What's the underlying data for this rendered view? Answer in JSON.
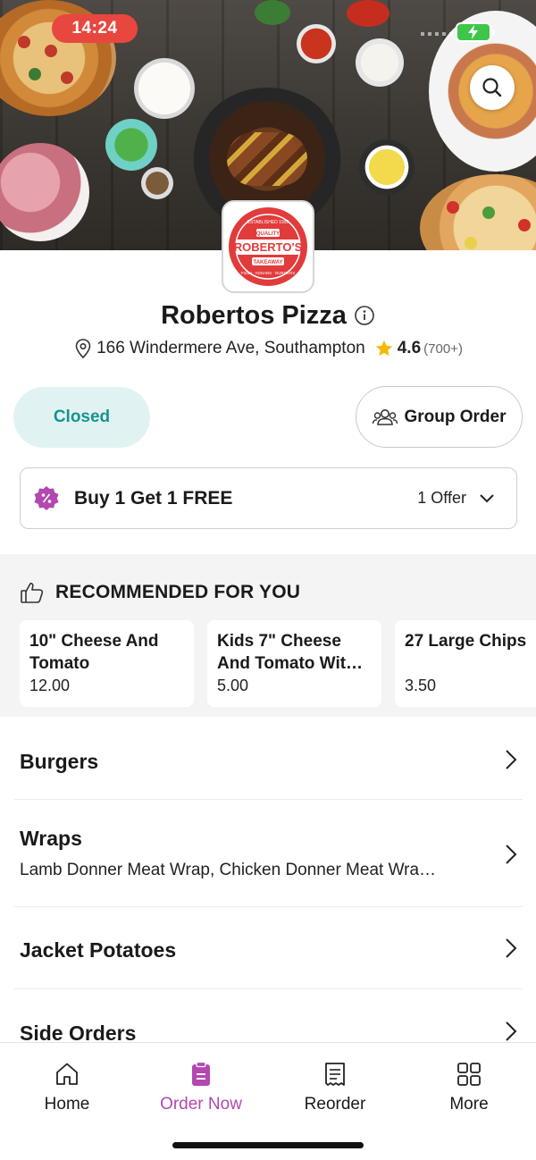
{
  "status_bar": {
    "time": "14:24"
  },
  "hero": {
    "search_icon": "search-icon"
  },
  "logo": {
    "top_text": "ESTABLISHED 1999",
    "quality": "QUALITY",
    "name": "ROBERTO'S",
    "takeaway": "TAKEAWAY",
    "bottom_text": "PIZZA · KEBABS · BURGERS"
  },
  "store": {
    "name": "Robertos Pizza",
    "address": "166 Windermere Ave, Southampton",
    "rating": "4.6",
    "rating_count": "(700+)"
  },
  "actions": {
    "closed_label": "Closed",
    "group_order_label": "Group Order"
  },
  "offer": {
    "title": "Buy 1 Get 1 FREE",
    "count_label": "1 Offer"
  },
  "recommended": {
    "heading": "RECOMMENDED FOR YOU",
    "items": [
      {
        "name": "10\" Cheese And Tomato",
        "price": "12.00"
      },
      {
        "name": "Kids 7\" Cheese And Tomato Wit…",
        "price": "5.00"
      },
      {
        "name": "27 Large Chips",
        "price": "3.50"
      }
    ]
  },
  "categories": [
    {
      "title": "Burgers",
      "subtitle": ""
    },
    {
      "title": "Wraps",
      "subtitle": "Lamb Donner Meat Wrap, Chicken Donner Meat Wra…"
    },
    {
      "title": "Jacket Potatoes",
      "subtitle": ""
    },
    {
      "title": "Side Orders",
      "subtitle": ""
    }
  ],
  "tabbar": {
    "tabs": [
      {
        "label": "Home",
        "icon": "home-icon"
      },
      {
        "label": "Order Now",
        "icon": "order-icon"
      },
      {
        "label": "Reorder",
        "icon": "receipt-icon"
      },
      {
        "label": "More",
        "icon": "grid-icon"
      }
    ],
    "active_color": "#b248b0"
  },
  "colors": {
    "closed_bg": "#e0f3f2",
    "closed_text": "#17938e",
    "accent": "#b248b0",
    "time_pill": "#e8473f",
    "star": "#f5b800"
  }
}
